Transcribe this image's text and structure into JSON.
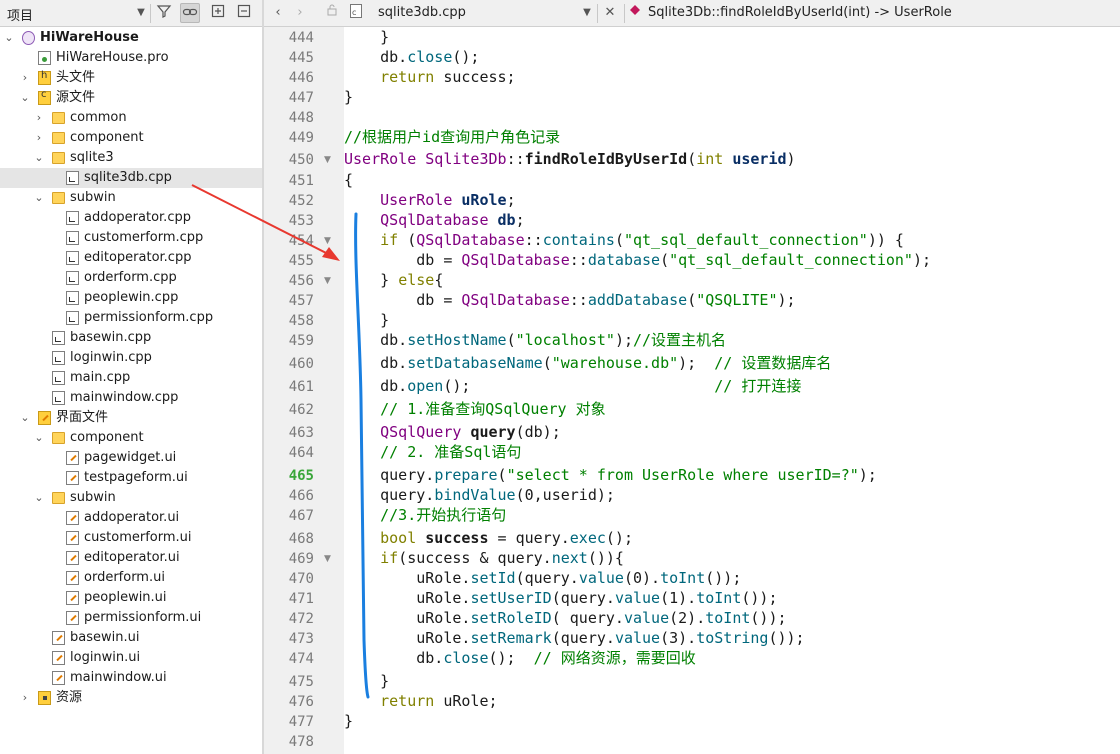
{
  "project_panel": {
    "title": "项目",
    "tree": [
      {
        "label": "HiWareHouse",
        "depth": 0,
        "icon": "project-icon",
        "expanded": true,
        "bold": true
      },
      {
        "label": "HiWareHouse.pro",
        "depth": 1,
        "icon": "pro-file-icon"
      },
      {
        "label": "头文件",
        "depth": 1,
        "icon": "headers-folder-icon",
        "expanded": false
      },
      {
        "label": "源文件",
        "depth": 1,
        "icon": "sources-folder-icon",
        "expanded": true
      },
      {
        "label": "common",
        "depth": 2,
        "icon": "folder-icon",
        "expanded": false
      },
      {
        "label": "component",
        "depth": 2,
        "icon": "folder-icon",
        "expanded": false
      },
      {
        "label": "sqlite3",
        "depth": 2,
        "icon": "folder-icon",
        "expanded": true
      },
      {
        "label": "sqlite3db.cpp",
        "depth": 3,
        "icon": "cpp-file-icon",
        "selected": true
      },
      {
        "label": "subwin",
        "depth": 2,
        "icon": "folder-icon",
        "expanded": true
      },
      {
        "label": "addoperator.cpp",
        "depth": 3,
        "icon": "cpp-file-icon"
      },
      {
        "label": "customerform.cpp",
        "depth": 3,
        "icon": "cpp-file-icon"
      },
      {
        "label": "editoperator.cpp",
        "depth": 3,
        "icon": "cpp-file-icon"
      },
      {
        "label": "orderform.cpp",
        "depth": 3,
        "icon": "cpp-file-icon"
      },
      {
        "label": "peoplewin.cpp",
        "depth": 3,
        "icon": "cpp-file-icon"
      },
      {
        "label": "permissionform.cpp",
        "depth": 3,
        "icon": "cpp-file-icon"
      },
      {
        "label": "basewin.cpp",
        "depth": 2,
        "icon": "cpp-file-icon"
      },
      {
        "label": "loginwin.cpp",
        "depth": 2,
        "icon": "cpp-file-icon"
      },
      {
        "label": "main.cpp",
        "depth": 2,
        "icon": "cpp-file-icon"
      },
      {
        "label": "mainwindow.cpp",
        "depth": 2,
        "icon": "cpp-file-icon"
      },
      {
        "label": "界面文件",
        "depth": 1,
        "icon": "forms-folder-icon",
        "expanded": true
      },
      {
        "label": "component",
        "depth": 2,
        "icon": "folder-icon",
        "expanded": true
      },
      {
        "label": "pagewidget.ui",
        "depth": 3,
        "icon": "ui-file-icon"
      },
      {
        "label": "testpageform.ui",
        "depth": 3,
        "icon": "ui-file-icon"
      },
      {
        "label": "subwin",
        "depth": 2,
        "icon": "folder-icon",
        "expanded": true
      },
      {
        "label": "addoperator.ui",
        "depth": 3,
        "icon": "ui-file-icon"
      },
      {
        "label": "customerform.ui",
        "depth": 3,
        "icon": "ui-file-icon"
      },
      {
        "label": "editoperator.ui",
        "depth": 3,
        "icon": "ui-file-icon"
      },
      {
        "label": "orderform.ui",
        "depth": 3,
        "icon": "ui-file-icon"
      },
      {
        "label": "peoplewin.ui",
        "depth": 3,
        "icon": "ui-file-icon"
      },
      {
        "label": "permissionform.ui",
        "depth": 3,
        "icon": "ui-file-icon"
      },
      {
        "label": "basewin.ui",
        "depth": 2,
        "icon": "ui-file-icon"
      },
      {
        "label": "loginwin.ui",
        "depth": 2,
        "icon": "ui-file-icon"
      },
      {
        "label": "mainwindow.ui",
        "depth": 2,
        "icon": "ui-file-icon"
      },
      {
        "label": "资源",
        "depth": 1,
        "icon": "resources-folder-icon",
        "expanded": false
      }
    ]
  },
  "editor": {
    "file_name": "sqlite3db.cpp",
    "symbol": "Sqlite3Db::findRoleIdByUserId(int) -> UserRole",
    "current_line": 465,
    "lines": [
      {
        "n": 444,
        "code": [
          [
            "    }",
            ""
          ]
        ]
      },
      {
        "n": 445,
        "code": [
          [
            "    db.",
            ""
          ],
          [
            "close",
            "f"
          ],
          [
            "();",
            ""
          ]
        ]
      },
      {
        "n": 446,
        "code": [
          [
            "    ",
            ""
          ],
          [
            "return",
            "k"
          ],
          [
            " success;",
            ""
          ]
        ]
      },
      {
        "n": 447,
        "code": [
          [
            "}",
            ""
          ]
        ]
      },
      {
        "n": 448,
        "code": []
      },
      {
        "n": 449,
        "code": [
          [
            "//根据用户id查询用户角色记录",
            "c"
          ]
        ]
      },
      {
        "n": 450,
        "fold": true,
        "code": [
          [
            "UserRole",
            "t"
          ],
          [
            " ",
            ""
          ],
          [
            "Sqlite3Db",
            "t"
          ],
          [
            "::",
            ""
          ],
          [
            "findRoleIdByUserId",
            "b"
          ],
          [
            "(",
            ""
          ],
          [
            "int",
            "k"
          ],
          [
            " ",
            ""
          ],
          [
            "userid",
            "v"
          ],
          [
            ")",
            ""
          ]
        ]
      },
      {
        "n": 451,
        "code": [
          [
            "{",
            ""
          ]
        ]
      },
      {
        "n": 452,
        "code": [
          [
            "    ",
            ""
          ],
          [
            "UserRole",
            "t"
          ],
          [
            " ",
            ""
          ],
          [
            "uRole",
            "v"
          ],
          [
            ";",
            ""
          ]
        ]
      },
      {
        "n": 453,
        "code": [
          [
            "    ",
            ""
          ],
          [
            "QSqlDatabase",
            "t"
          ],
          [
            " ",
            ""
          ],
          [
            "db",
            "v"
          ],
          [
            ";",
            ""
          ]
        ]
      },
      {
        "n": 454,
        "fold": true,
        "code": [
          [
            "    ",
            ""
          ],
          [
            "if",
            "k"
          ],
          [
            " (",
            ""
          ],
          [
            "QSqlDatabase",
            "t"
          ],
          [
            "::",
            ""
          ],
          [
            "contains",
            "f"
          ],
          [
            "(",
            ""
          ],
          [
            "\"qt_sql_default_connection\"",
            "s"
          ],
          [
            ")) {",
            ""
          ]
        ]
      },
      {
        "n": 455,
        "code": [
          [
            "        db = ",
            ""
          ],
          [
            "QSqlDatabase",
            "t"
          ],
          [
            "::",
            ""
          ],
          [
            "database",
            "f"
          ],
          [
            "(",
            ""
          ],
          [
            "\"qt_sql_default_connection\"",
            "s"
          ],
          [
            ");",
            ""
          ]
        ]
      },
      {
        "n": 456,
        "fold": true,
        "code": [
          [
            "    } ",
            ""
          ],
          [
            "else",
            "k"
          ],
          [
            "{",
            ""
          ]
        ]
      },
      {
        "n": 457,
        "code": [
          [
            "        db = ",
            ""
          ],
          [
            "QSqlDatabase",
            "t"
          ],
          [
            "::",
            ""
          ],
          [
            "addDatabase",
            "f"
          ],
          [
            "(",
            ""
          ],
          [
            "\"QSQLITE\"",
            "s"
          ],
          [
            ");",
            ""
          ]
        ]
      },
      {
        "n": 458,
        "code": [
          [
            "    }",
            ""
          ]
        ]
      },
      {
        "n": 459,
        "code": [
          [
            "    db.",
            ""
          ],
          [
            "setHostName",
            "f"
          ],
          [
            "(",
            ""
          ],
          [
            "\"localhost\"",
            "s"
          ],
          [
            ");",
            ""
          ],
          [
            "//设置主机名",
            "c"
          ]
        ]
      },
      {
        "n": 460,
        "code": [
          [
            "    db.",
            ""
          ],
          [
            "setDatabaseName",
            "f"
          ],
          [
            "(",
            ""
          ],
          [
            "\"warehouse.db\"",
            "s"
          ],
          [
            ");  ",
            ""
          ],
          [
            "// 设置数据库名",
            "c"
          ]
        ]
      },
      {
        "n": 461,
        "code": [
          [
            "    db.",
            ""
          ],
          [
            "open",
            "f"
          ],
          [
            "();                           ",
            ""
          ],
          [
            "// 打开连接",
            "c"
          ]
        ]
      },
      {
        "n": 462,
        "code": [
          [
            "    ",
            ""
          ],
          [
            "// 1.准备查询QSqlQuery 对象",
            "c"
          ]
        ]
      },
      {
        "n": 463,
        "code": [
          [
            "    ",
            ""
          ],
          [
            "QSqlQuery",
            "t"
          ],
          [
            " ",
            ""
          ],
          [
            "query",
            "b"
          ],
          [
            "(db);",
            ""
          ]
        ]
      },
      {
        "n": 464,
        "code": [
          [
            "    ",
            ""
          ],
          [
            "// 2. 准备Sql语句",
            "c"
          ]
        ]
      },
      {
        "n": 465,
        "code": [
          [
            "    query.",
            ""
          ],
          [
            "prepare",
            "f"
          ],
          [
            "(",
            ""
          ],
          [
            "\"select * from UserRole where userID=?\"",
            "s"
          ],
          [
            ");",
            ""
          ]
        ]
      },
      {
        "n": 466,
        "code": [
          [
            "    query.",
            ""
          ],
          [
            "bindValue",
            "f"
          ],
          [
            "(0,userid);",
            ""
          ]
        ]
      },
      {
        "n": 467,
        "code": [
          [
            "    ",
            ""
          ],
          [
            "//3.开始执行语句",
            "c"
          ]
        ]
      },
      {
        "n": 468,
        "code": [
          [
            "    ",
            ""
          ],
          [
            "bool",
            "k"
          ],
          [
            " ",
            ""
          ],
          [
            "success",
            "b"
          ],
          [
            " = query.",
            ""
          ],
          [
            "exec",
            "f"
          ],
          [
            "();",
            ""
          ]
        ]
      },
      {
        "n": 469,
        "fold": true,
        "code": [
          [
            "    ",
            ""
          ],
          [
            "if",
            "k"
          ],
          [
            "(success & query.",
            ""
          ],
          [
            "next",
            "f"
          ],
          [
            "()){",
            ""
          ]
        ]
      },
      {
        "n": 470,
        "code": [
          [
            "        uRole.",
            ""
          ],
          [
            "setId",
            "f"
          ],
          [
            "(query.",
            ""
          ],
          [
            "value",
            "f"
          ],
          [
            "(0).",
            ""
          ],
          [
            "toInt",
            "f"
          ],
          [
            "());",
            ""
          ]
        ]
      },
      {
        "n": 471,
        "code": [
          [
            "        uRole.",
            ""
          ],
          [
            "setUserID",
            "f"
          ],
          [
            "(query.",
            ""
          ],
          [
            "value",
            "f"
          ],
          [
            "(1).",
            ""
          ],
          [
            "toInt",
            "f"
          ],
          [
            "());",
            ""
          ]
        ]
      },
      {
        "n": 472,
        "code": [
          [
            "        uRole.",
            ""
          ],
          [
            "setRoleID",
            "f"
          ],
          [
            "( query.",
            ""
          ],
          [
            "value",
            "f"
          ],
          [
            "(2).",
            ""
          ],
          [
            "toInt",
            "f"
          ],
          [
            "());",
            ""
          ]
        ]
      },
      {
        "n": 473,
        "code": [
          [
            "        uRole.",
            ""
          ],
          [
            "setRemark",
            "f"
          ],
          [
            "(query.",
            ""
          ],
          [
            "value",
            "f"
          ],
          [
            "(3).",
            ""
          ],
          [
            "toString",
            "f"
          ],
          [
            "());",
            ""
          ]
        ]
      },
      {
        "n": 474,
        "code": [
          [
            "        db.",
            ""
          ],
          [
            "close",
            "f"
          ],
          [
            "();  ",
            ""
          ],
          [
            "// 网络资源，需要回收",
            "c"
          ]
        ]
      },
      {
        "n": 475,
        "code": [
          [
            "    }",
            ""
          ]
        ]
      },
      {
        "n": 476,
        "code": [
          [
            "    ",
            ""
          ],
          [
            "return",
            "k"
          ],
          [
            " uRole;",
            ""
          ]
        ]
      },
      {
        "n": 477,
        "code": [
          [
            "}",
            ""
          ]
        ]
      },
      {
        "n": 478,
        "code": []
      }
    ]
  },
  "annotations": {
    "arrow_color": "#e8382f",
    "bracket_color": "#1a7fe0"
  }
}
